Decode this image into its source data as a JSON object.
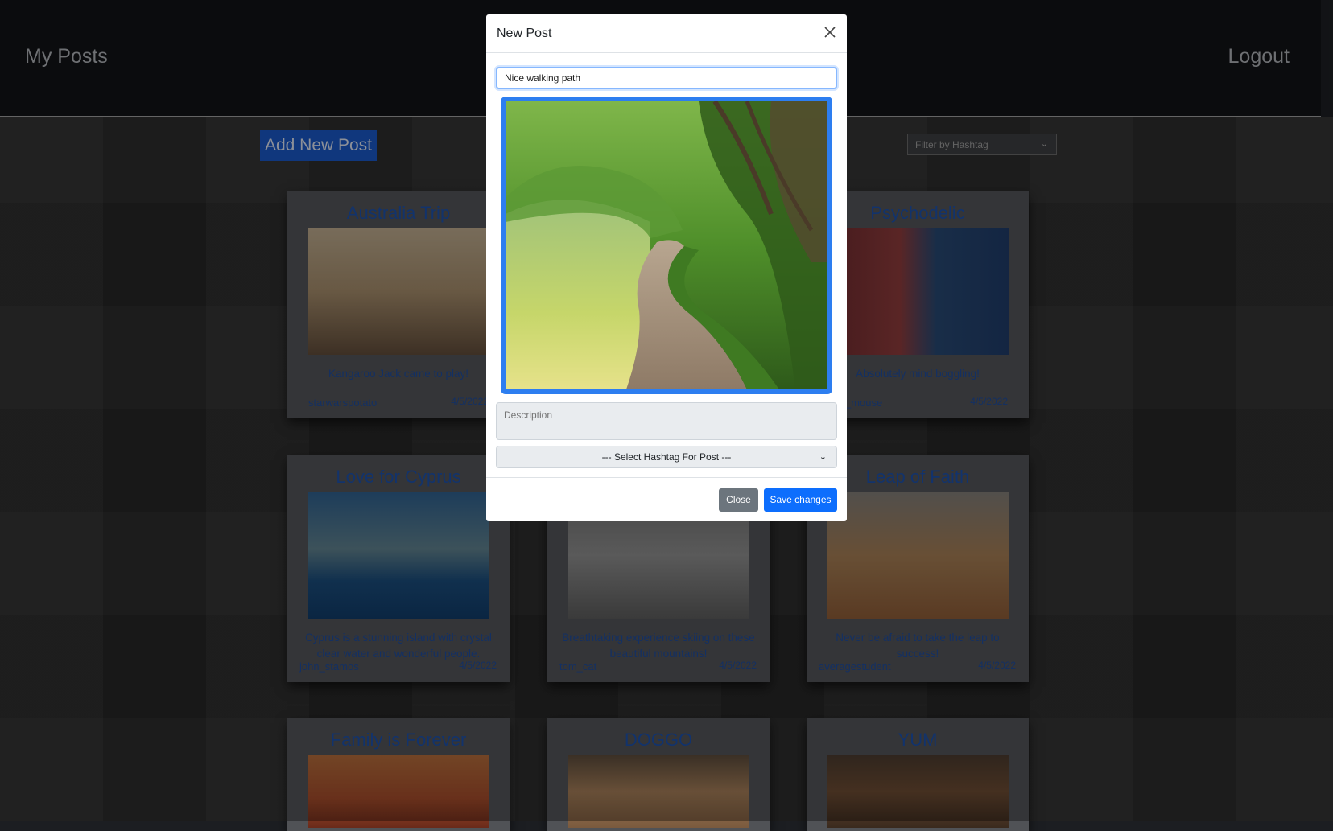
{
  "navbar": {
    "brand": "My Posts",
    "logout": "Logout"
  },
  "toolbar": {
    "add_post": "Add New Post",
    "filter_placeholder": "Filter by Hashtag"
  },
  "posts": [
    {
      "title": "Australia Trip",
      "description": "Kangaroo Jack came to play!",
      "user": "starwarspotato",
      "date": "4/5/2022"
    },
    {
      "title": "Psychodelic",
      "description": "Absolutely mind boggling!",
      "user": "_mouse",
      "date": "4/5/2022"
    },
    {
      "title": "Love for Cyprus",
      "description": "Cyprus is a stunning island with crystal clear water and wonderful people.",
      "user": "john_stamos",
      "date": "4/5/2022"
    },
    {
      "title": "",
      "description": "Breathtaking experience skiing on these beautiful mountains!",
      "user": "tom_cat",
      "date": "4/5/2022"
    },
    {
      "title": "Leap of Faith",
      "description": "Never be afraid to take the leap to success!",
      "user": "averagestudent",
      "date": "4/5/2022"
    },
    {
      "title": "Family is Forever",
      "description": "",
      "user": "",
      "date": ""
    },
    {
      "title": "DOGGO",
      "description": "",
      "user": "",
      "date": ""
    },
    {
      "title": "YUM",
      "description": "",
      "user": "",
      "date": ""
    }
  ],
  "modal": {
    "title": "New Post",
    "title_value": "Nice walking path",
    "description_placeholder": "Description",
    "hashtag_select": "--- Select Hashtag For Post ---",
    "close_button": "Close",
    "save_button": "Save changes"
  },
  "colors": {
    "primary": "#0d6efd",
    "secondary": "#6c757d",
    "navbar": "#121316"
  }
}
